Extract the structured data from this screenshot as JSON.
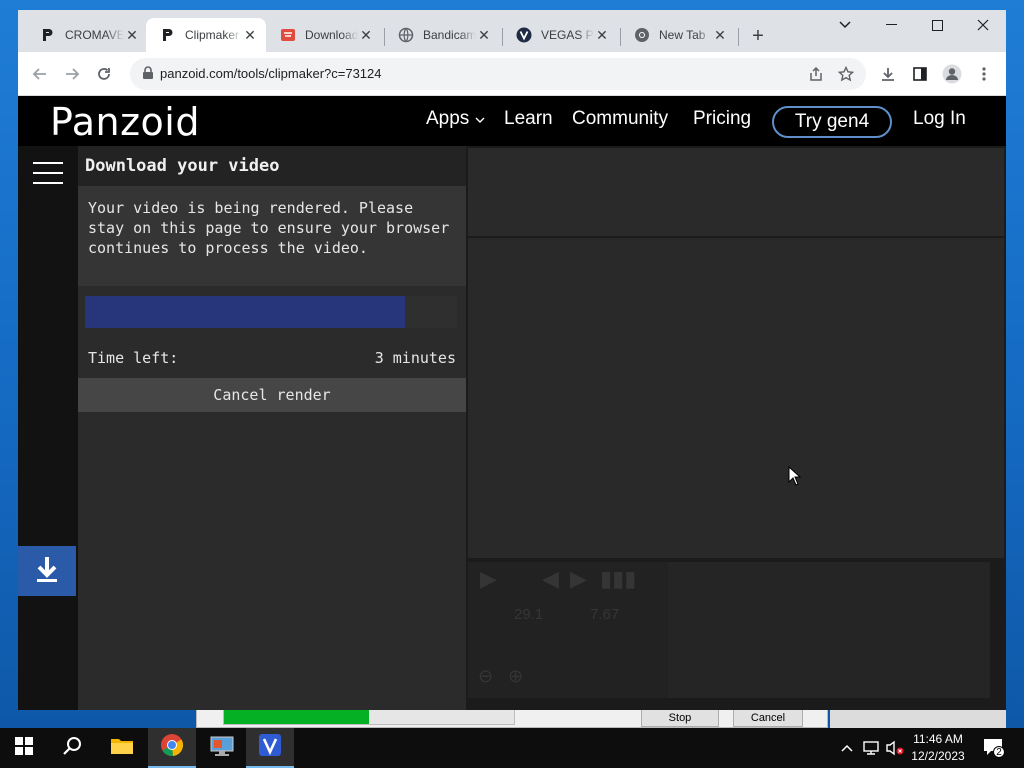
{
  "browser": {
    "tabs": [
      {
        "title": "CROMAVE",
        "favicon": "panzoid-icon",
        "active": false
      },
      {
        "title": "Clipmaker",
        "favicon": "panzoid-icon",
        "active": true
      },
      {
        "title": "Download",
        "favicon": "download-site-icon",
        "active": false
      },
      {
        "title": "Bandicam",
        "favicon": "globe-icon",
        "active": false
      },
      {
        "title": "VEGAS Pro",
        "favicon": "vegas-icon",
        "active": false
      },
      {
        "title": "New Tab",
        "favicon": "chrome-icon",
        "active": false
      }
    ],
    "new_tab_symbol": "+",
    "url": "panzoid.com/tools/clipmaker?c=73124"
  },
  "site": {
    "logo": "Panzoid",
    "nav": {
      "apps": "Apps",
      "learn": "Learn",
      "community": "Community",
      "pricing": "Pricing",
      "try": "Try gen4",
      "login": "Log In"
    }
  },
  "panel": {
    "title": "Download your video",
    "message": "Your video is being rendered. Please stay on this page to ensure your browser continues to process the video.",
    "progress_percent": 86,
    "time_left_label": "Time left:",
    "time_left_value": "3 minutes",
    "cancel_label": "Cancel render"
  },
  "background_app": {
    "progress_percent": 50,
    "stop_label": "Stop",
    "cancel_label": "Cancel"
  },
  "player": {
    "current_time": "29.1",
    "total_time": "7.67"
  },
  "taskbar": {
    "time": "11:46 AM",
    "date": "12/2/2023",
    "notification_count": "2"
  },
  "colors": {
    "accent": "#2a5aa8",
    "progress": "#27367a",
    "try_border": "#5e8fc9"
  }
}
